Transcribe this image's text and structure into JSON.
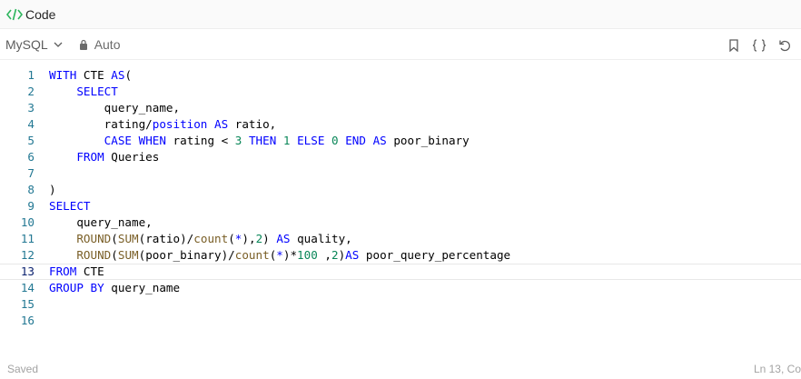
{
  "header": {
    "title": "Code",
    "icon": "code-icon",
    "icon_color": "#2db55d"
  },
  "toolbar": {
    "language": "MySQL",
    "mode": "Auto",
    "buttons": [
      "bookmark-icon",
      "braces-icon",
      "undo-icon"
    ]
  },
  "editor": {
    "lines": [
      {
        "n": "1",
        "tokens": [
          [
            "kw",
            "WITH"
          ],
          [
            "op",
            " CTE "
          ],
          [
            "kw",
            "AS"
          ],
          [
            "op",
            "("
          ]
        ]
      },
      {
        "n": "2",
        "tokens": [
          [
            "op",
            "    "
          ],
          [
            "kw",
            "SELECT"
          ]
        ]
      },
      {
        "n": "3",
        "tokens": [
          [
            "op",
            "        query_name,"
          ]
        ]
      },
      {
        "n": "4",
        "tokens": [
          [
            "op",
            "        rating/"
          ],
          [
            "kw",
            "position"
          ],
          [
            "op",
            " "
          ],
          [
            "kw",
            "AS"
          ],
          [
            "op",
            " ratio,"
          ]
        ]
      },
      {
        "n": "5",
        "tokens": [
          [
            "op",
            "        "
          ],
          [
            "kw",
            "CASE"
          ],
          [
            "op",
            " "
          ],
          [
            "kw",
            "WHEN"
          ],
          [
            "op",
            " rating < "
          ],
          [
            "num",
            "3"
          ],
          [
            "op",
            " "
          ],
          [
            "kw",
            "THEN"
          ],
          [
            "op",
            " "
          ],
          [
            "num",
            "1"
          ],
          [
            "op",
            " "
          ],
          [
            "kw",
            "ELSE"
          ],
          [
            "op",
            " "
          ],
          [
            "num",
            "0"
          ],
          [
            "op",
            " "
          ],
          [
            "kw",
            "END"
          ],
          [
            "op",
            " "
          ],
          [
            "kw",
            "AS"
          ],
          [
            "op",
            " poor_binary"
          ]
        ]
      },
      {
        "n": "6",
        "tokens": [
          [
            "op",
            "    "
          ],
          [
            "kw",
            "FROM"
          ],
          [
            "op",
            " Queries"
          ]
        ]
      },
      {
        "n": "7",
        "tokens": []
      },
      {
        "n": "8",
        "tokens": [
          [
            "op",
            ")"
          ]
        ]
      },
      {
        "n": "9",
        "tokens": [
          [
            "kw",
            "SELECT"
          ]
        ]
      },
      {
        "n": "10",
        "tokens": [
          [
            "op",
            "    query_name,"
          ]
        ]
      },
      {
        "n": "11",
        "tokens": [
          [
            "op",
            "    "
          ],
          [
            "fn",
            "ROUND"
          ],
          [
            "op",
            "("
          ],
          [
            "fn",
            "SUM"
          ],
          [
            "op",
            "(ratio)/"
          ],
          [
            "fn",
            "count"
          ],
          [
            "op",
            "("
          ],
          [
            "kw",
            "*"
          ],
          [
            "op",
            "),"
          ],
          [
            "num",
            "2"
          ],
          [
            "op",
            ") "
          ],
          [
            "kw",
            "AS"
          ],
          [
            "op",
            " quality,"
          ]
        ]
      },
      {
        "n": "12",
        "tokens": [
          [
            "op",
            "    "
          ],
          [
            "fn",
            "ROUND"
          ],
          [
            "op",
            "("
          ],
          [
            "fn",
            "SUM"
          ],
          [
            "op",
            "(poor_binary)/"
          ],
          [
            "fn",
            "count"
          ],
          [
            "op",
            "("
          ],
          [
            "kw",
            "*"
          ],
          [
            "op",
            ")*"
          ],
          [
            "num",
            "100"
          ],
          [
            "op",
            " ,"
          ],
          [
            "num",
            "2"
          ],
          [
            "op",
            ")"
          ],
          [
            "kw",
            "AS"
          ],
          [
            "op",
            " poor_query_percentage"
          ]
        ]
      },
      {
        "n": "13",
        "tokens": [
          [
            "kw",
            "FROM"
          ],
          [
            "op",
            " CTE"
          ]
        ],
        "active": true
      },
      {
        "n": "14",
        "tokens": [
          [
            "kw",
            "GROUP BY"
          ],
          [
            "op",
            " query_name"
          ]
        ]
      },
      {
        "n": "15",
        "tokens": []
      },
      {
        "n": "16",
        "tokens": []
      }
    ]
  },
  "status": {
    "saved": "Saved",
    "position": "Ln 13, Co"
  }
}
